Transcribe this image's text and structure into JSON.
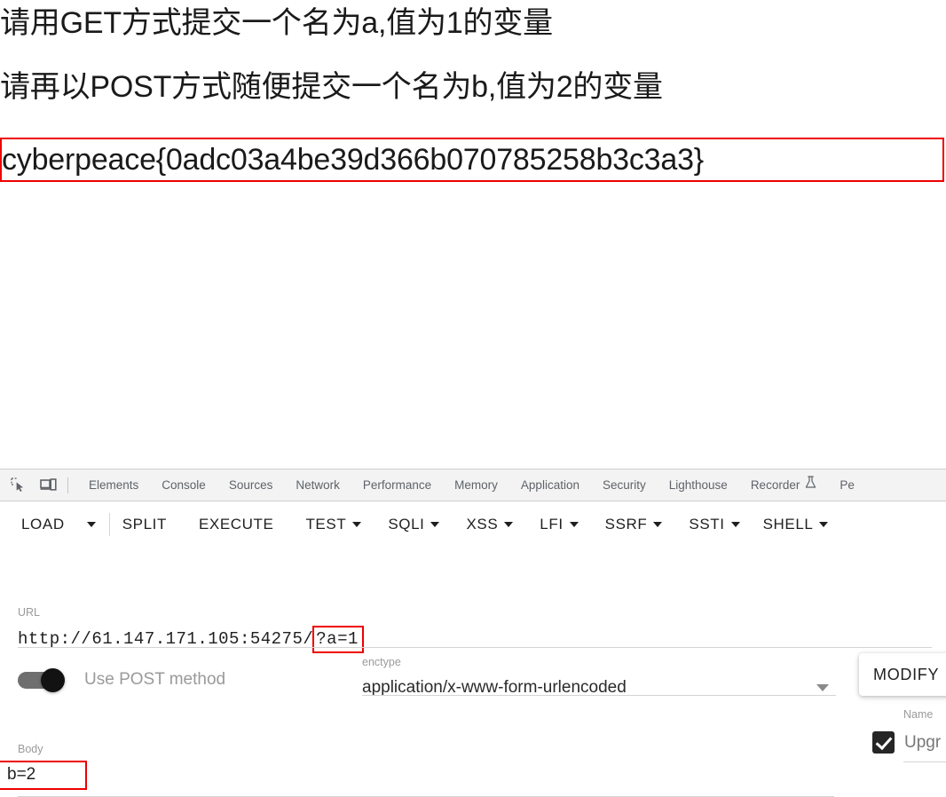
{
  "page": {
    "challenge_line_1": "请用GET方式提交一个名为a,值为1的变量",
    "challenge_line_2": "请再以POST方式随便提交一个名为b,值为2的变量",
    "flag": "cyberpeace{0adc03a4be39d366b070785258b3c3a3}"
  },
  "devtools": {
    "icons": [
      {
        "name": "inspect-element-icon",
        "glyph": "inspect"
      },
      {
        "name": "device-toolbar-icon",
        "glyph": "device"
      }
    ],
    "tabs": [
      {
        "label": "Elements"
      },
      {
        "label": "Console"
      },
      {
        "label": "Sources"
      },
      {
        "label": "Network"
      },
      {
        "label": "Performance"
      },
      {
        "label": "Memory"
      },
      {
        "label": "Application"
      },
      {
        "label": "Security"
      },
      {
        "label": "Lighthouse"
      },
      {
        "label": "Recorder",
        "icon": "flask-icon"
      },
      {
        "label": "Pe"
      }
    ]
  },
  "hackbar": {
    "toolbar": [
      {
        "label": "LOAD",
        "caret": true
      },
      {
        "label": "SPLIT",
        "caret": false
      },
      {
        "label": "EXECUTE",
        "caret": false
      },
      {
        "label": "TEST",
        "caret": true
      },
      {
        "label": "SQLI",
        "caret": true
      },
      {
        "label": "XSS",
        "caret": true
      },
      {
        "label": "LFI",
        "caret": true
      },
      {
        "label": "SSRF",
        "caret": true
      },
      {
        "label": "SSTI",
        "caret": true
      },
      {
        "label": "SHELL",
        "caret": true
      }
    ],
    "url": {
      "label": "URL",
      "base": "http://61.147.171.105:54275/",
      "query_highlighted": "?a=1"
    },
    "post_toggle": {
      "label": "Use POST method",
      "enabled": true
    },
    "enctype": {
      "label": "enctype",
      "value": "application/x-www-form-urlencoded"
    },
    "modify_button": {
      "label": "MODIFY"
    },
    "headers": {
      "name_label": "Name",
      "row_label": "Upgr",
      "checked": true
    },
    "body": {
      "label": "Body",
      "value": "b=2"
    }
  },
  "colors": {
    "highlight_red": "#ee0000",
    "tab_text": "#5f6368",
    "toolbar_bg": "#f3f3f3",
    "muted_label": "#9a9a9a"
  }
}
